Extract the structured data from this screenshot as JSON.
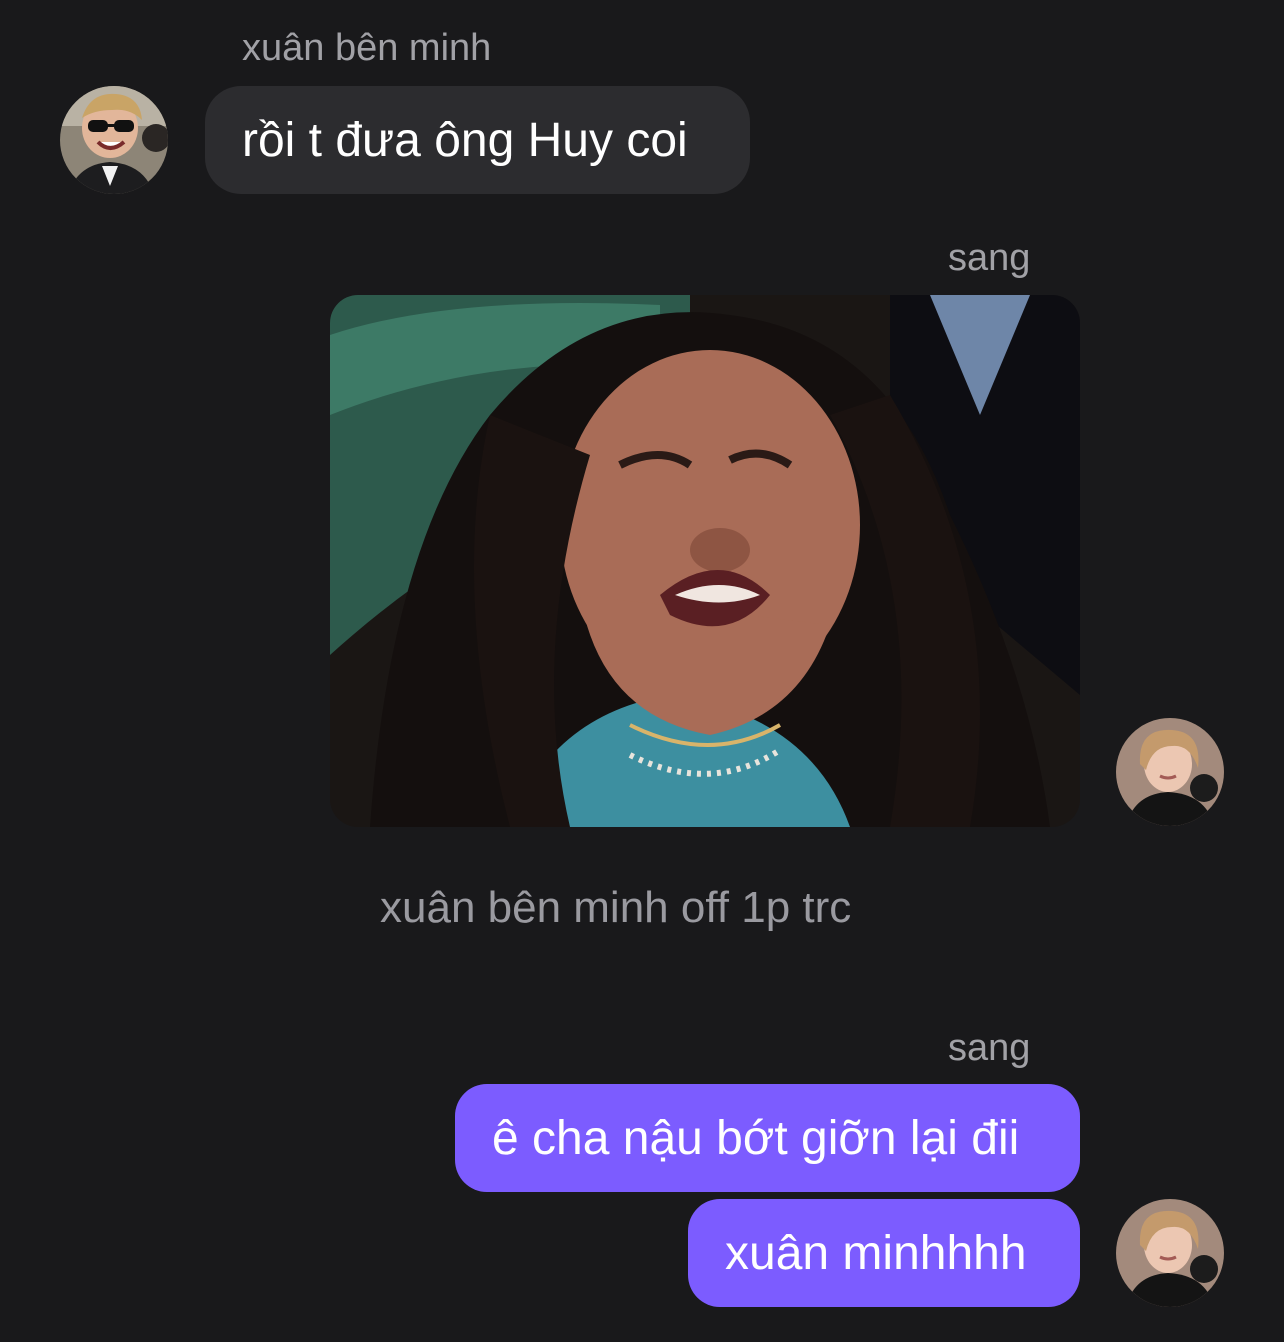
{
  "messages": {
    "incoming": {
      "sender": "xuân bên minh",
      "text": "rồi t đưa ông Huy coi",
      "avatar_icon": "contact-avatar"
    },
    "photo_message": {
      "sender": "sang",
      "image": "meme-photo-woman-laughing"
    },
    "status_line": "xuân bên minh off 1p trc",
    "outgoing_group": {
      "sender": "sang",
      "texts": [
        "ê cha nậu bớt giỡn lại đii",
        "xuân minhhhh"
      ]
    }
  },
  "colors": {
    "background": "#19191b",
    "incoming_bubble": "#2c2c2f",
    "outgoing_bubble": "#7c5cff",
    "secondary_text": "#a1a1a6"
  }
}
